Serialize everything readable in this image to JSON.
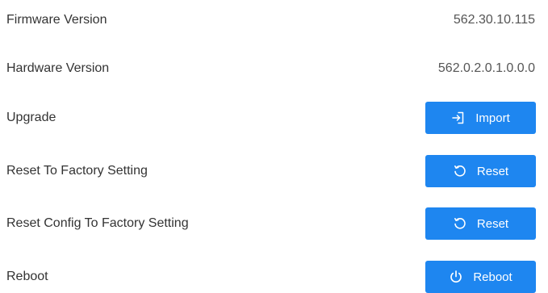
{
  "settings": {
    "firmware": {
      "label": "Firmware Version",
      "value": "562.30.10.115"
    },
    "hardware": {
      "label": "Hardware Version",
      "value": "562.0.2.0.1.0.0.0"
    },
    "upgrade": {
      "label": "Upgrade",
      "button_label": "Import",
      "icon": "import-icon"
    },
    "reset_factory": {
      "label": "Reset To Factory Setting",
      "button_label": "Reset",
      "icon": "reset-icon"
    },
    "reset_config": {
      "label": "Reset Config To Factory Setting",
      "button_label": "Reset",
      "icon": "reset-icon"
    },
    "reboot": {
      "label": "Reboot",
      "button_label": "Reboot",
      "icon": "power-icon"
    }
  },
  "colors": {
    "button_bg": "#1e86f0",
    "button_text": "#ffffff",
    "label_text": "#333333",
    "value_text": "#555555"
  }
}
